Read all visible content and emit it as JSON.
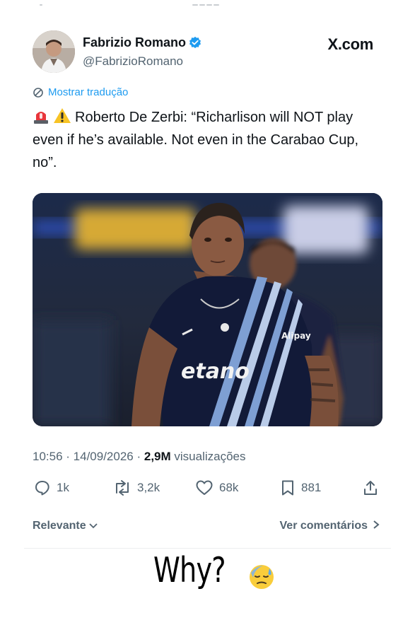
{
  "tweet": {
    "author_name": "Fabrizio Romano",
    "handle": "@FabrizioRomano",
    "site": "X.com",
    "translate_label": "Mostrar tradução",
    "text": "Roberto De Zerbi: “Richarlison will NOT play even if he’s available. Not even in the Carabao Cup, no”.",
    "time": "10:56",
    "date": "14/09/2026",
    "views": "2,9M",
    "views_label": "visualizações",
    "replies": "1k",
    "reposts": "3,2k",
    "likes": "68k",
    "bookmarks": "881",
    "sort_label": "Relevante",
    "comments_link": "Ver comentários"
  },
  "photo": {
    "sponsor_text": "etano",
    "sleeve_text": "Alipay"
  },
  "story": {
    "caption": "Why?"
  },
  "icons": [
    "verified-badge-icon",
    "translate-icon",
    "siren-emoji-icon",
    "warning-emoji-icon",
    "reply-icon",
    "repost-icon",
    "like-icon",
    "bookmark-icon",
    "share-icon",
    "chevron-down-icon",
    "chevron-right-icon",
    "sweat-face-emoji-icon"
  ],
  "colors": {
    "accent": "#1d9bf0",
    "muted": "#536471",
    "text": "#0f1419"
  }
}
